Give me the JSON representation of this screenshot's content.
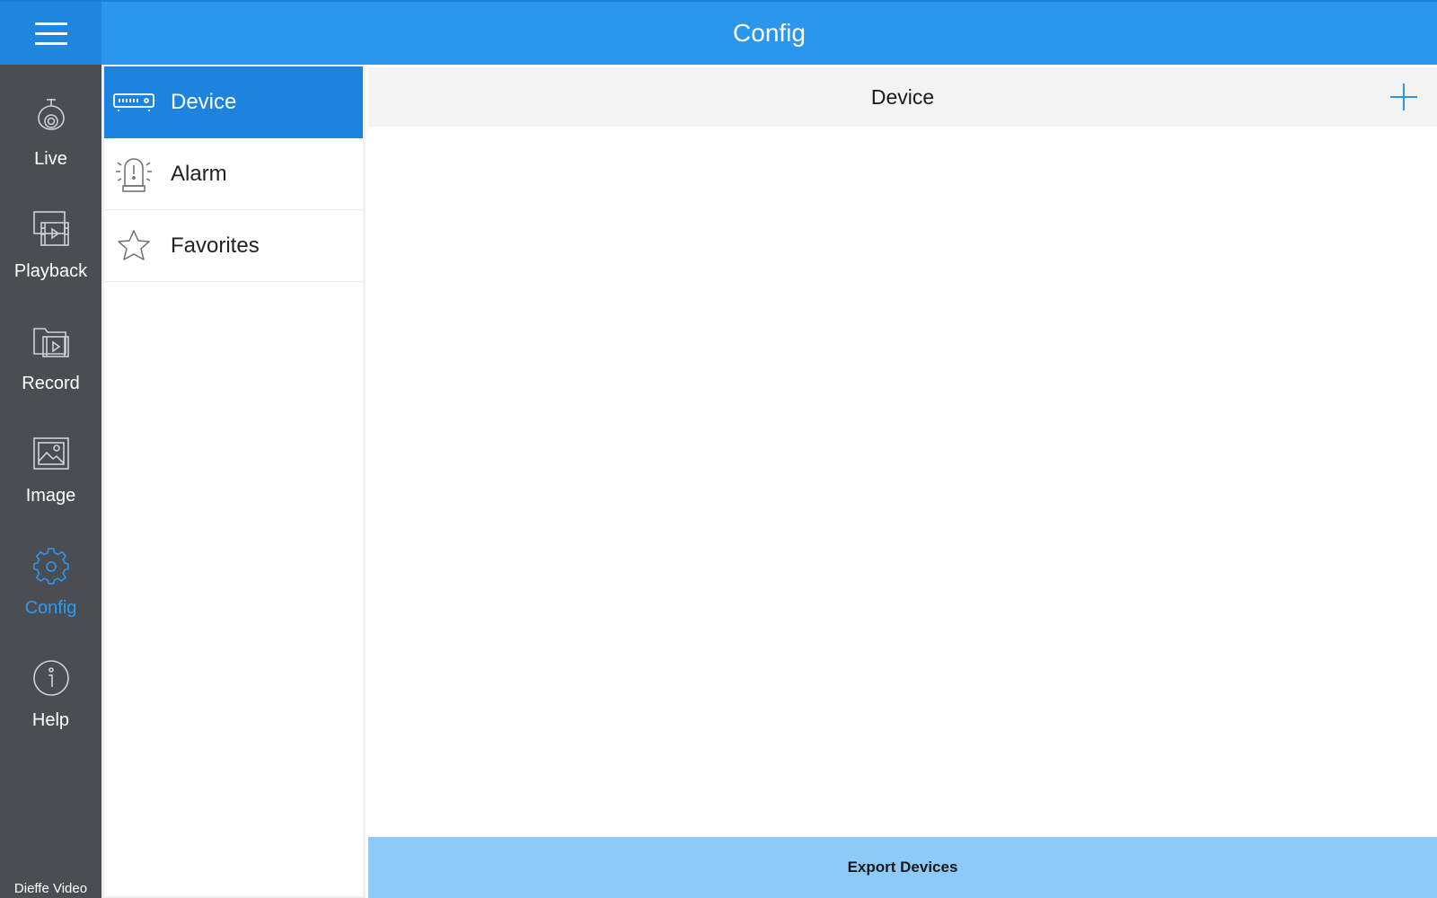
{
  "header": {
    "title": "Config",
    "menu_icon": "hamburger-menu-icon"
  },
  "rail": {
    "items": [
      {
        "label": "Live",
        "icon": "camera-icon",
        "active": false
      },
      {
        "label": "Playback",
        "icon": "playback-icon",
        "active": false
      },
      {
        "label": "Record",
        "icon": "record-folder-icon",
        "active": false
      },
      {
        "label": "Image",
        "icon": "image-icon",
        "active": false
      },
      {
        "label": "Config",
        "icon": "gear-icon",
        "active": true
      },
      {
        "label": "Help",
        "icon": "info-icon",
        "active": false
      }
    ],
    "brand": "Dieffe Video"
  },
  "config_menu": {
    "items": [
      {
        "label": "Device",
        "icon": "dvr-device-icon",
        "active": true
      },
      {
        "label": "Alarm",
        "icon": "alarm-beacon-icon",
        "active": false
      },
      {
        "label": "Favorites",
        "icon": "star-icon",
        "active": false
      }
    ]
  },
  "content": {
    "title": "Device",
    "add_icon": "plus-icon",
    "export_label": "Export Devices"
  },
  "colors": {
    "topbar": "#2b96ee",
    "accent": "#1c83df",
    "rail_bg": "#4a4d52",
    "active_rail_label": "#2d9af5",
    "export_bg": "#8dcaf7"
  }
}
